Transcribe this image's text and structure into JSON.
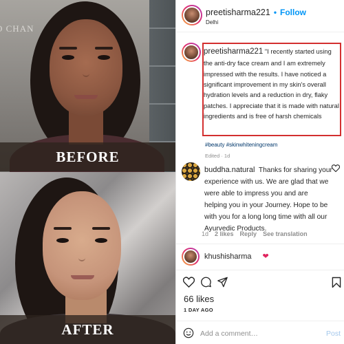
{
  "photo": {
    "wall_text": "O CHAN",
    "before_label": "BEFORE",
    "after_label": "AFTER"
  },
  "post": {
    "username": "preetisharma221",
    "follow_separator": "•",
    "follow_label": "Follow",
    "location": "Delhi",
    "caption_username": "preetisharma221",
    "caption": "\"I recently started using the anti-dry face cream and I am extremely impressed with the results. I have noticed a significant improvement in my skin's overall hydration levels and a reduction in dry, flaky patches. I appreciate that it is made with natural ingredients and is free of harsh chemicals",
    "hashtags": "#beauty #skinwhiteningcream",
    "edited": "Edited · 1d"
  },
  "comments": [
    {
      "username": "buddha.natural",
      "text": "Thanks for sharing your experience with us. We are glad that we were able to impress you and are helping you in your Journey. Hope to be with you for a long long time with all our Ayurvedic Products.",
      "time": "1d",
      "likes": "2 likes",
      "reply": "Reply",
      "see_translation": "See translation"
    },
    {
      "username": "khushisharma",
      "emoji": "❤"
    }
  ],
  "actions": {
    "likes_count": "66 likes",
    "date": "1 DAY AGO",
    "add_comment_placeholder": "Add a comment…",
    "post_label": "Post"
  },
  "colors": {
    "accent": "#0095f6",
    "highlight_border": "#d32f2f",
    "heart": "#ed4956"
  }
}
